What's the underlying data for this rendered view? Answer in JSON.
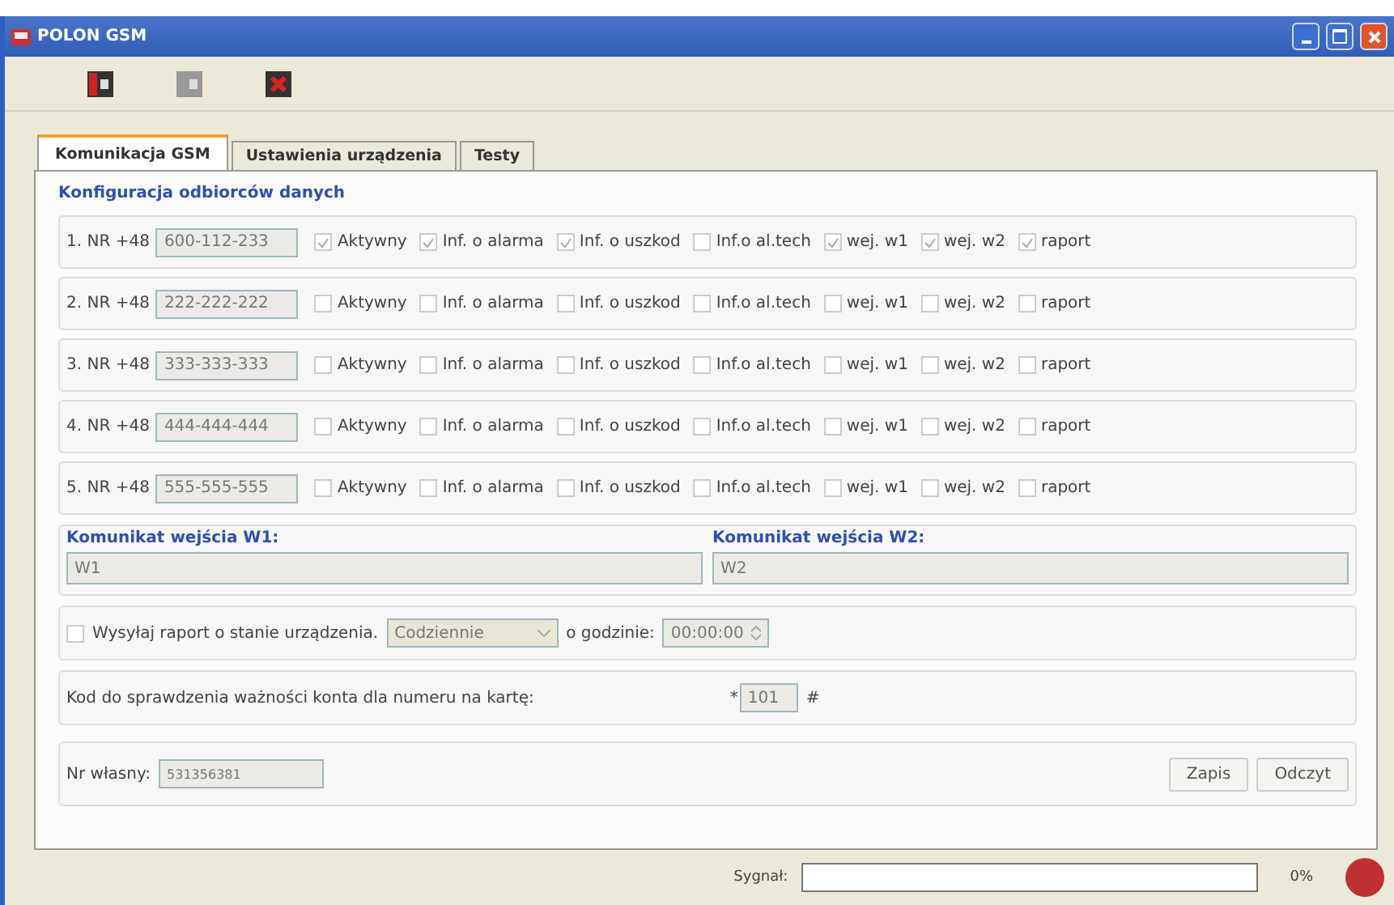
{
  "window": {
    "title": "POLON GSM"
  },
  "toolbar": {
    "buttons": [
      {
        "kind": "connect",
        "disabled": false
      },
      {
        "kind": "disconnect",
        "disabled": true
      },
      {
        "kind": "exit",
        "disabled": false
      }
    ]
  },
  "tabs": [
    {
      "label": "Komunikacja GSM",
      "selected": true
    },
    {
      "label": "Ustawienia urządzenia",
      "selected": false
    },
    {
      "label": "Testy",
      "selected": false
    }
  ],
  "receivers": {
    "title": "Konfiguracja odbiorców danych",
    "rows": [
      {
        "label": "1. NR +48",
        "number": "600-112-233",
        "options": [
          {
            "label": "Aktywny",
            "checked": true
          },
          {
            "label": "Inf. o alarma",
            "checked": true
          },
          {
            "label": "Inf. o uszkod",
            "checked": true
          },
          {
            "label": "Inf.o al.tech",
            "checked": false
          },
          {
            "label": "wej. w1",
            "checked": true
          },
          {
            "label": "wej. w2",
            "checked": true
          },
          {
            "label": "raport",
            "checked": true
          }
        ]
      },
      {
        "label": "2. NR +48",
        "number": "222-222-222",
        "options": [
          {
            "label": "Aktywny",
            "checked": false
          },
          {
            "label": "Inf. o alarma",
            "checked": false
          },
          {
            "label": "Inf. o uszkod",
            "checked": false
          },
          {
            "label": "Inf.o al.tech",
            "checked": false
          },
          {
            "label": "wej. w1",
            "checked": false
          },
          {
            "label": "wej. w2",
            "checked": false
          },
          {
            "label": "raport",
            "checked": false
          }
        ]
      },
      {
        "label": "3. NR +48",
        "number": "333-333-333",
        "options": [
          {
            "label": "Aktywny",
            "checked": false
          },
          {
            "label": "Inf. o alarma",
            "checked": false
          },
          {
            "label": "Inf. o uszkod",
            "checked": false
          },
          {
            "label": "Inf.o al.tech",
            "checked": false
          },
          {
            "label": "wej. w1",
            "checked": false
          },
          {
            "label": "wej. w2",
            "checked": false
          },
          {
            "label": "raport",
            "checked": false
          }
        ]
      },
      {
        "label": "4. NR +48",
        "number": "444-444-444",
        "options": [
          {
            "label": "Aktywny",
            "checked": false
          },
          {
            "label": "Inf. o alarma",
            "checked": false
          },
          {
            "label": "Inf. o uszkod",
            "checked": false
          },
          {
            "label": "Inf.o al.tech",
            "checked": false
          },
          {
            "label": "wej. w1",
            "checked": false
          },
          {
            "label": "wej. w2",
            "checked": false
          },
          {
            "label": "raport",
            "checked": false
          }
        ]
      },
      {
        "label": "5. NR +48",
        "number": "555-555-555",
        "options": [
          {
            "label": "Aktywny",
            "checked": false
          },
          {
            "label": "Inf. o alarma",
            "checked": false
          },
          {
            "label": "Inf. o uszkod",
            "checked": false
          },
          {
            "label": "Inf.o al.tech",
            "checked": false
          },
          {
            "label": "wej. w1",
            "checked": false
          },
          {
            "label": "wej. w2",
            "checked": false
          },
          {
            "label": "raport",
            "checked": false
          }
        ]
      }
    ]
  },
  "messages": [
    {
      "title": "Komunikat wejścia W1:",
      "value": "W1"
    },
    {
      "title": "Komunikat wejścia W2:",
      "value": "W2"
    }
  ],
  "report": {
    "label": "Wysyłaj raport o stanie urządzenia.",
    "checked": false,
    "frequency": "Codziennie",
    "time_label": "o godzinie:",
    "time": "00:00:00"
  },
  "account_code": {
    "label": "Kod do sprawdzenia ważności konta dla numeru na kartę:",
    "prefix": "*",
    "value": "101",
    "suffix": "#"
  },
  "own_number": {
    "label": "Nr własny:",
    "value": "531356381"
  },
  "buttons": [
    "Zapis",
    "Odczyt"
  ],
  "status_bar": {
    "signal_label": "Sygnał:",
    "percent": "0%",
    "connected": false
  }
}
